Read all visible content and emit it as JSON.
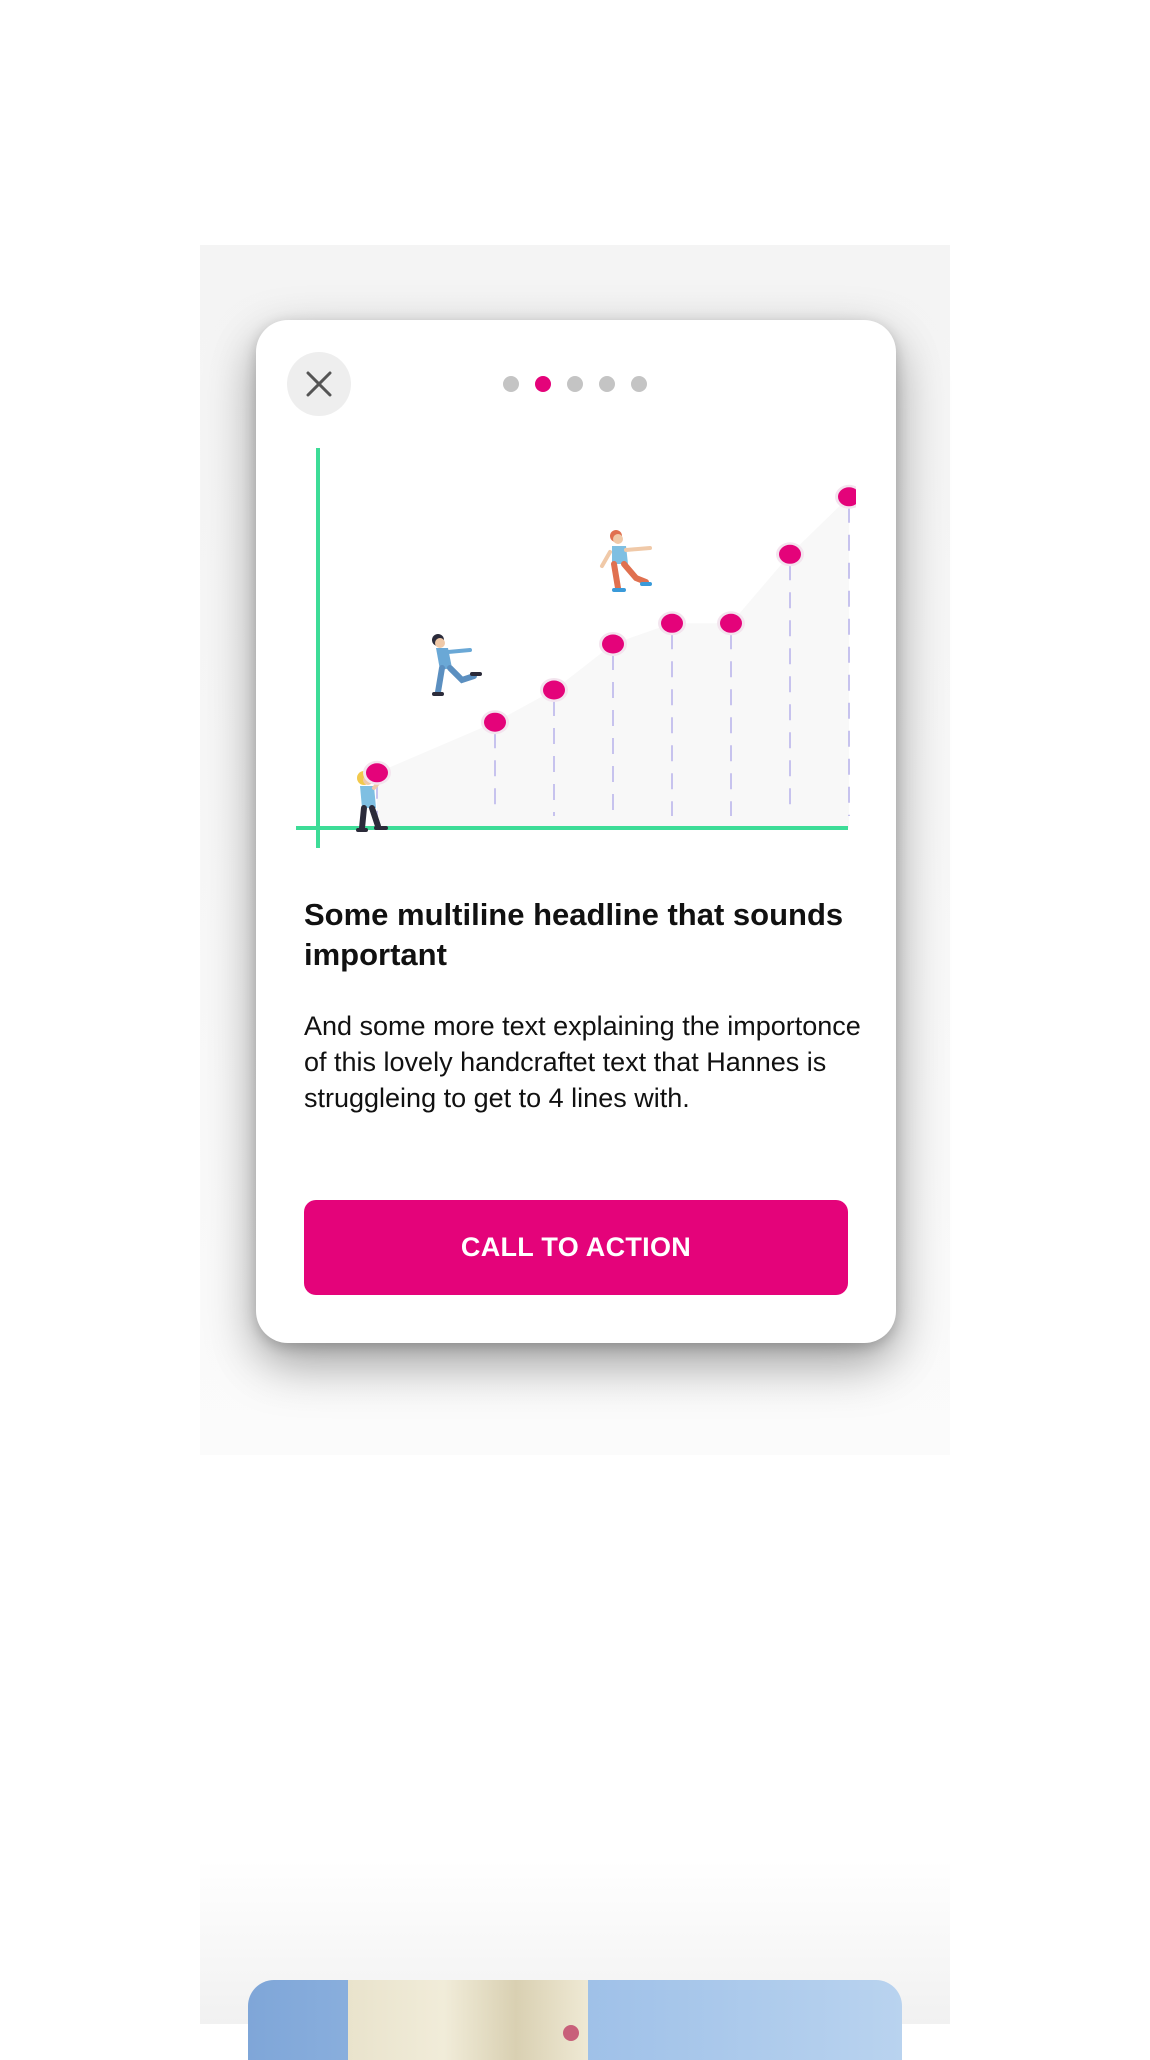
{
  "modal": {
    "close_icon": "close-icon",
    "pagination": {
      "count": 5,
      "active_index": 1,
      "active_color": "#e4037a",
      "inactive_color": "#c4c4c4"
    },
    "illustration": {
      "description_icon": "growth-chart-with-climbers-illustration",
      "axis_color": "#3ddc97",
      "point_color": "#e4037a",
      "stem_color": "#c7c3ee",
      "points": [
        1,
        3,
        4,
        5,
        6,
        7,
        8,
        9
      ],
      "values": [
        1.2,
        2.3,
        3.0,
        4.0,
        4.45,
        4.45,
        5.95,
        7.2
      ]
    },
    "headline": "Some multiline headline that sounds important",
    "body": "And some more text explaining the importonce of this lovely handcraftet text that Hannes is struggleing to get to 4 lines with.",
    "cta_label": "CALL TO ACTION",
    "cta_color": "#e4037a"
  }
}
